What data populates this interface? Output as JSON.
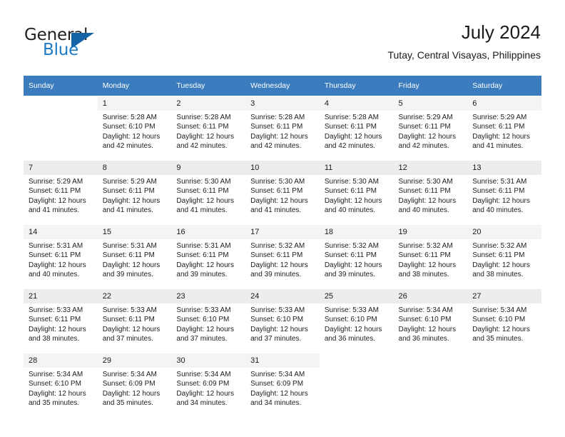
{
  "brand": {
    "name_part1": "General",
    "name_part2": "Blue",
    "flag_icon": "triangle-flag-icon",
    "accent_color": "#1763a8"
  },
  "header": {
    "title": "July 2024",
    "subtitle": "Tutay, Central Visayas, Philippines"
  },
  "theme": {
    "header_row_bg": "#3a7cbe",
    "day_number_bg": "#efefef",
    "text_color": "#1a1a1a"
  },
  "calendar": {
    "weekday_headers": [
      "Sunday",
      "Monday",
      "Tuesday",
      "Wednesday",
      "Thursday",
      "Friday",
      "Saturday"
    ],
    "weeks": [
      [
        {
          "day": "",
          "lines": []
        },
        {
          "day": "1",
          "lines": [
            "Sunrise: 5:28 AM",
            "Sunset: 6:10 PM",
            "Daylight: 12 hours",
            "and 42 minutes."
          ]
        },
        {
          "day": "2",
          "lines": [
            "Sunrise: 5:28 AM",
            "Sunset: 6:11 PM",
            "Daylight: 12 hours",
            "and 42 minutes."
          ]
        },
        {
          "day": "3",
          "lines": [
            "Sunrise: 5:28 AM",
            "Sunset: 6:11 PM",
            "Daylight: 12 hours",
            "and 42 minutes."
          ]
        },
        {
          "day": "4",
          "lines": [
            "Sunrise: 5:28 AM",
            "Sunset: 6:11 PM",
            "Daylight: 12 hours",
            "and 42 minutes."
          ]
        },
        {
          "day": "5",
          "lines": [
            "Sunrise: 5:29 AM",
            "Sunset: 6:11 PM",
            "Daylight: 12 hours",
            "and 42 minutes."
          ]
        },
        {
          "day": "6",
          "lines": [
            "Sunrise: 5:29 AM",
            "Sunset: 6:11 PM",
            "Daylight: 12 hours",
            "and 41 minutes."
          ]
        }
      ],
      [
        {
          "day": "7",
          "lines": [
            "Sunrise: 5:29 AM",
            "Sunset: 6:11 PM",
            "Daylight: 12 hours",
            "and 41 minutes."
          ]
        },
        {
          "day": "8",
          "lines": [
            "Sunrise: 5:29 AM",
            "Sunset: 6:11 PM",
            "Daylight: 12 hours",
            "and 41 minutes."
          ]
        },
        {
          "day": "9",
          "lines": [
            "Sunrise: 5:30 AM",
            "Sunset: 6:11 PM",
            "Daylight: 12 hours",
            "and 41 minutes."
          ]
        },
        {
          "day": "10",
          "lines": [
            "Sunrise: 5:30 AM",
            "Sunset: 6:11 PM",
            "Daylight: 12 hours",
            "and 41 minutes."
          ]
        },
        {
          "day": "11",
          "lines": [
            "Sunrise: 5:30 AM",
            "Sunset: 6:11 PM",
            "Daylight: 12 hours",
            "and 40 minutes."
          ]
        },
        {
          "day": "12",
          "lines": [
            "Sunrise: 5:30 AM",
            "Sunset: 6:11 PM",
            "Daylight: 12 hours",
            "and 40 minutes."
          ]
        },
        {
          "day": "13",
          "lines": [
            "Sunrise: 5:31 AM",
            "Sunset: 6:11 PM",
            "Daylight: 12 hours",
            "and 40 minutes."
          ]
        }
      ],
      [
        {
          "day": "14",
          "lines": [
            "Sunrise: 5:31 AM",
            "Sunset: 6:11 PM",
            "Daylight: 12 hours",
            "and 40 minutes."
          ]
        },
        {
          "day": "15",
          "lines": [
            "Sunrise: 5:31 AM",
            "Sunset: 6:11 PM",
            "Daylight: 12 hours",
            "and 39 minutes."
          ]
        },
        {
          "day": "16",
          "lines": [
            "Sunrise: 5:31 AM",
            "Sunset: 6:11 PM",
            "Daylight: 12 hours",
            "and 39 minutes."
          ]
        },
        {
          "day": "17",
          "lines": [
            "Sunrise: 5:32 AM",
            "Sunset: 6:11 PM",
            "Daylight: 12 hours",
            "and 39 minutes."
          ]
        },
        {
          "day": "18",
          "lines": [
            "Sunrise: 5:32 AM",
            "Sunset: 6:11 PM",
            "Daylight: 12 hours",
            "and 39 minutes."
          ]
        },
        {
          "day": "19",
          "lines": [
            "Sunrise: 5:32 AM",
            "Sunset: 6:11 PM",
            "Daylight: 12 hours",
            "and 38 minutes."
          ]
        },
        {
          "day": "20",
          "lines": [
            "Sunrise: 5:32 AM",
            "Sunset: 6:11 PM",
            "Daylight: 12 hours",
            "and 38 minutes."
          ]
        }
      ],
      [
        {
          "day": "21",
          "lines": [
            "Sunrise: 5:33 AM",
            "Sunset: 6:11 PM",
            "Daylight: 12 hours",
            "and 38 minutes."
          ]
        },
        {
          "day": "22",
          "lines": [
            "Sunrise: 5:33 AM",
            "Sunset: 6:11 PM",
            "Daylight: 12 hours",
            "and 37 minutes."
          ]
        },
        {
          "day": "23",
          "lines": [
            "Sunrise: 5:33 AM",
            "Sunset: 6:10 PM",
            "Daylight: 12 hours",
            "and 37 minutes."
          ]
        },
        {
          "day": "24",
          "lines": [
            "Sunrise: 5:33 AM",
            "Sunset: 6:10 PM",
            "Daylight: 12 hours",
            "and 37 minutes."
          ]
        },
        {
          "day": "25",
          "lines": [
            "Sunrise: 5:33 AM",
            "Sunset: 6:10 PM",
            "Daylight: 12 hours",
            "and 36 minutes."
          ]
        },
        {
          "day": "26",
          "lines": [
            "Sunrise: 5:34 AM",
            "Sunset: 6:10 PM",
            "Daylight: 12 hours",
            "and 36 minutes."
          ]
        },
        {
          "day": "27",
          "lines": [
            "Sunrise: 5:34 AM",
            "Sunset: 6:10 PM",
            "Daylight: 12 hours",
            "and 35 minutes."
          ]
        }
      ],
      [
        {
          "day": "28",
          "lines": [
            "Sunrise: 5:34 AM",
            "Sunset: 6:10 PM",
            "Daylight: 12 hours",
            "and 35 minutes."
          ]
        },
        {
          "day": "29",
          "lines": [
            "Sunrise: 5:34 AM",
            "Sunset: 6:09 PM",
            "Daylight: 12 hours",
            "and 35 minutes."
          ]
        },
        {
          "day": "30",
          "lines": [
            "Sunrise: 5:34 AM",
            "Sunset: 6:09 PM",
            "Daylight: 12 hours",
            "and 34 minutes."
          ]
        },
        {
          "day": "31",
          "lines": [
            "Sunrise: 5:34 AM",
            "Sunset: 6:09 PM",
            "Daylight: 12 hours",
            "and 34 minutes."
          ]
        },
        {
          "day": "",
          "lines": []
        },
        {
          "day": "",
          "lines": []
        },
        {
          "day": "",
          "lines": []
        }
      ]
    ]
  }
}
